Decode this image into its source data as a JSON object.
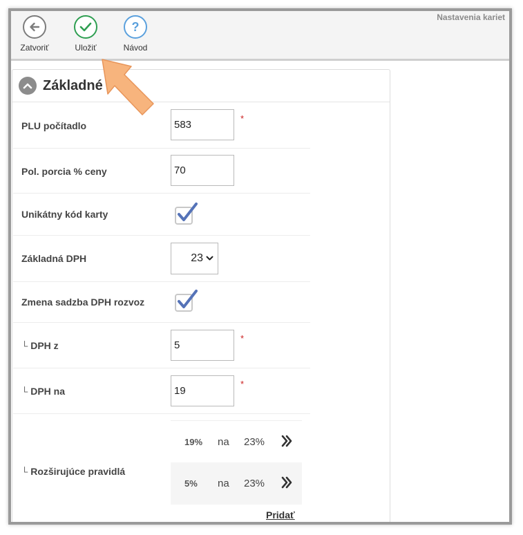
{
  "header": {
    "page_title": "Nastavenia kariet"
  },
  "toolbar": {
    "back_label": "Zatvoriť",
    "save_label": "Uložiť",
    "help_label": "Návod",
    "help_glyph": "?"
  },
  "panel": {
    "title": "Základné"
  },
  "form": {
    "plu_counter": {
      "label": "PLU počítadlo",
      "value": "583",
      "required_mark": "*"
    },
    "half_portion_price": {
      "label": "Pol. porcia % ceny",
      "value": "70"
    },
    "unique_card_code": {
      "label": "Unikátny kód karty",
      "checked": true
    },
    "base_vat": {
      "label": "Základná DPH",
      "value": "23"
    },
    "change_vat_delivery": {
      "label": "Zmena sadzba DPH rozvoz",
      "checked": true
    },
    "vat_from": {
      "prefix": "└",
      "label": "DPH z",
      "value": "5",
      "required_mark": "*"
    },
    "vat_to": {
      "prefix": "└",
      "label": "DPH na",
      "value": "19",
      "required_mark": "*"
    },
    "extended_rules": {
      "prefix": "└",
      "label": "Rozširujúce pravidlá",
      "rules": [
        {
          "from": "19%",
          "connector": "na",
          "to": "23%",
          "action": "»"
        },
        {
          "from": "5%",
          "connector": "na",
          "to": "23%",
          "action": "»"
        }
      ],
      "add_label": "Pridať"
    }
  },
  "colors": {
    "accent_green": "#2e9e51",
    "help_blue": "#5aa0dd",
    "required_red": "#cc2222",
    "pointer_orange": "#f7b47d"
  }
}
